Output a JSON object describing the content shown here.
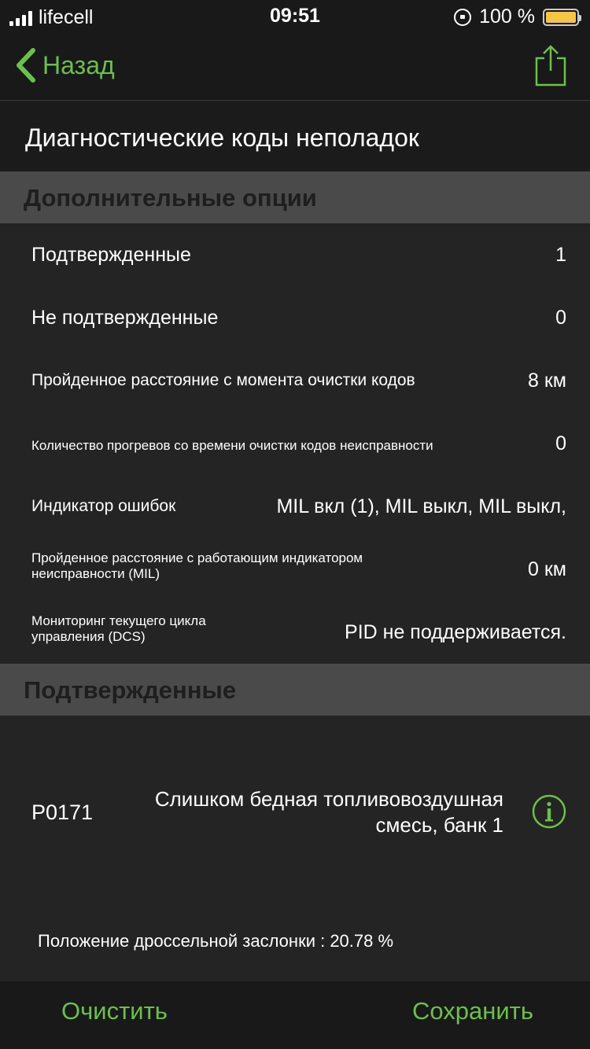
{
  "status_bar": {
    "carrier": "lifecell",
    "time": "09:51",
    "battery_percent": "100 %",
    "battery_level": 1.0,
    "battery_color": "#f5c544"
  },
  "nav": {
    "back_label": "Назад",
    "back_icon": "chevron-left-icon",
    "share_icon": "share-icon",
    "accent_color": "#6cc04a"
  },
  "title": "Диагностические коды неполадок",
  "sections": {
    "options_header": "Дополнительные опции",
    "confirmed_header": "Подтвержденные"
  },
  "options": [
    {
      "label": "Подтвержденные",
      "value": "1"
    },
    {
      "label": "Не подтвержденные",
      "value": "0"
    },
    {
      "label": "Пройденное расстояние с момента очистки кодов",
      "value": "8 км"
    },
    {
      "label": "Количество прогревов со времени очистки кодов неисправности",
      "value": "0"
    },
    {
      "label": "Индикатор ошибок",
      "value": "MIL вкл (1), MIL выкл, MIL выкл,"
    },
    {
      "label": "Пройденное расстояние с работающим индикатором неисправности (MIL)",
      "value": "0 км"
    },
    {
      "label": "Мониторинг текущего цикла управления (DCS)",
      "value": "PID не поддерживается."
    }
  ],
  "code": {
    "id": "P0171",
    "description": "Слишком бедная топливовоздушная смесь, банк 1",
    "info_icon": "info-icon",
    "throttle": "Положение дроссельной заслонки : 20.78 %"
  },
  "toolbar": {
    "clear_label": "Очистить",
    "save_label": "Сохранить"
  }
}
